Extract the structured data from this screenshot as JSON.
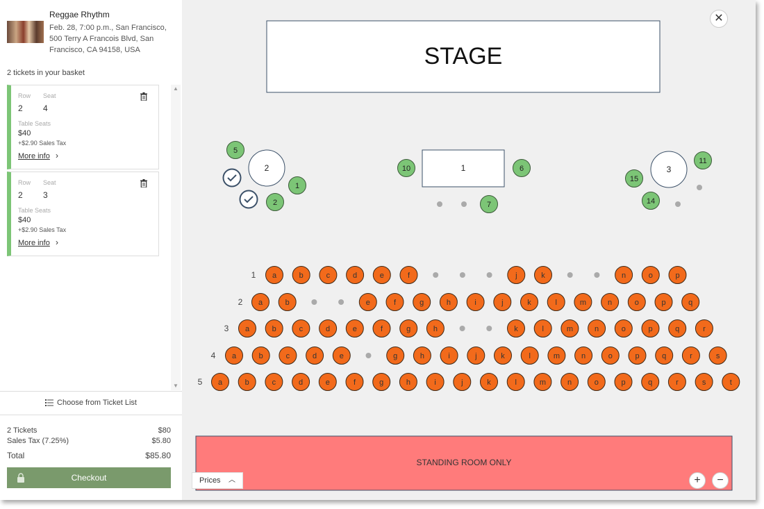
{
  "event": {
    "title": "Reggae Rhythm",
    "description": "Feb. 28, 7:00 p.m., San Francisco, 500 Terry A Francois Blvd, San Francisco, CA 94158, USA"
  },
  "basket": {
    "count_text": "2 tickets in your basket",
    "tickets": [
      {
        "row_label": "Row",
        "row": "2",
        "seat_label": "Seat",
        "seat": "4",
        "area": "Table Seats",
        "price": "$40",
        "tax": "+$2.90 Sales Tax",
        "more": "More info"
      },
      {
        "row_label": "Row",
        "row": "2",
        "seat_label": "Seat",
        "seat": "3",
        "area": "Table Seats",
        "price": "$40",
        "tax": "+$2.90 Sales Tax",
        "more": "More info"
      }
    ]
  },
  "choose_list": "Choose from Ticket List",
  "summary": {
    "tickets_label": "2 Tickets",
    "tickets_value": "$80",
    "tax_label": "Sales Tax (7.25%)",
    "tax_value": "$5.80",
    "total_label": "Total",
    "total_value": "$85.80"
  },
  "checkout": "Checkout",
  "map": {
    "stage": "STAGE",
    "standing": "STANDING ROOM ONLY",
    "prices": "Prices",
    "colors": {
      "available": "#f26a1b",
      "table_seat": "#7cc576",
      "standing": "#ff7b7b",
      "accent": "#3b5068"
    },
    "tables": [
      {
        "label": "2",
        "shape": "round",
        "seats": [
          {
            "label": "5",
            "state": "available"
          },
          {
            "label": "1",
            "state": "available"
          },
          {
            "label": "2",
            "state": "available"
          },
          {
            "label": "",
            "state": "selected"
          },
          {
            "label": "",
            "state": "selected"
          }
        ]
      },
      {
        "label": "1",
        "shape": "rect",
        "seats": [
          {
            "label": "10",
            "state": "available"
          },
          {
            "label": "6",
            "state": "available"
          },
          {
            "label": "7",
            "state": "available"
          },
          {
            "label": "",
            "state": "unavailable"
          },
          {
            "label": "",
            "state": "unavailable"
          }
        ]
      },
      {
        "label": "3",
        "shape": "round",
        "seats": [
          {
            "label": "11",
            "state": "available"
          },
          {
            "label": "15",
            "state": "available"
          },
          {
            "label": "14",
            "state": "available"
          },
          {
            "label": "",
            "state": "unavailable"
          },
          {
            "label": "",
            "state": "unavailable"
          }
        ]
      }
    ],
    "rows": [
      {
        "label": "1",
        "seats": [
          "a",
          "b",
          "c",
          "d",
          "e",
          "f",
          "",
          "",
          "",
          "j",
          "k",
          "",
          "",
          "n",
          "o",
          "p"
        ]
      },
      {
        "label": "2",
        "seats": [
          "a",
          "b",
          "",
          "",
          "e",
          "f",
          "g",
          "h",
          "i",
          "j",
          "k",
          "l",
          "m",
          "n",
          "o",
          "p",
          "q"
        ]
      },
      {
        "label": "3",
        "seats": [
          "a",
          "b",
          "c",
          "d",
          "e",
          "f",
          "g",
          "h",
          "",
          "",
          "k",
          "l",
          "m",
          "n",
          "o",
          "p",
          "q",
          "r"
        ]
      },
      {
        "label": "4",
        "seats": [
          "a",
          "b",
          "c",
          "d",
          "e",
          "",
          "g",
          "h",
          "i",
          "j",
          "k",
          "l",
          "m",
          "n",
          "o",
          "p",
          "q",
          "r",
          "s"
        ]
      },
      {
        "label": "5",
        "seats": [
          "a",
          "b",
          "c",
          "d",
          "e",
          "f",
          "g",
          "h",
          "i",
          "j",
          "k",
          "l",
          "m",
          "n",
          "o",
          "p",
          "q",
          "r",
          "s",
          "t"
        ]
      }
    ]
  }
}
